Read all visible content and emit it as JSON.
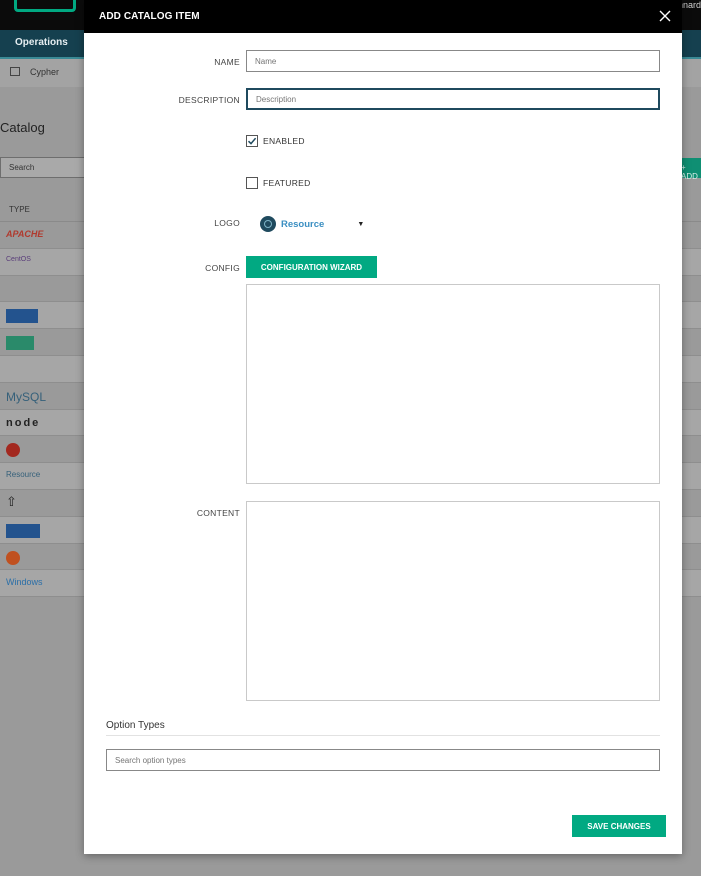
{
  "background": {
    "user_text": "nnard",
    "nav_item": "Operations",
    "subnav_item": "Cypher",
    "page_title": "Catalog",
    "search_placeholder": "Search",
    "add_label": "+ ADD",
    "table_header": "TYPE",
    "rows": [
      "APACHE",
      "CentOS",
      "",
      "",
      "",
      "",
      "MySQL",
      "node",
      "",
      "Resource",
      "",
      "",
      "",
      "Windows"
    ]
  },
  "modal": {
    "title": "ADD CATALOG ITEM",
    "close_icon": "close-icon",
    "name_label": "NAME",
    "name_placeholder": "Name",
    "name_value": "",
    "description_label": "DESCRIPTION",
    "description_placeholder": "Description",
    "description_value": "",
    "enabled_label": "ENABLED",
    "enabled_checked": true,
    "featured_label": "FEATURED",
    "featured_checked": false,
    "logo_label": "LOGO",
    "logo_value": "Resource",
    "config_label": "CONFIG",
    "config_button": "CONFIGURATION WIZARD",
    "content_label": "CONTENT",
    "option_types_title": "Option Types",
    "option_types_placeholder": "Search option types",
    "save_button": "SAVE CHANGES"
  },
  "colors": {
    "accent": "#01a982",
    "header": "#000000",
    "focus_border": "#1f4a5e",
    "link": "#3b8fc2"
  }
}
